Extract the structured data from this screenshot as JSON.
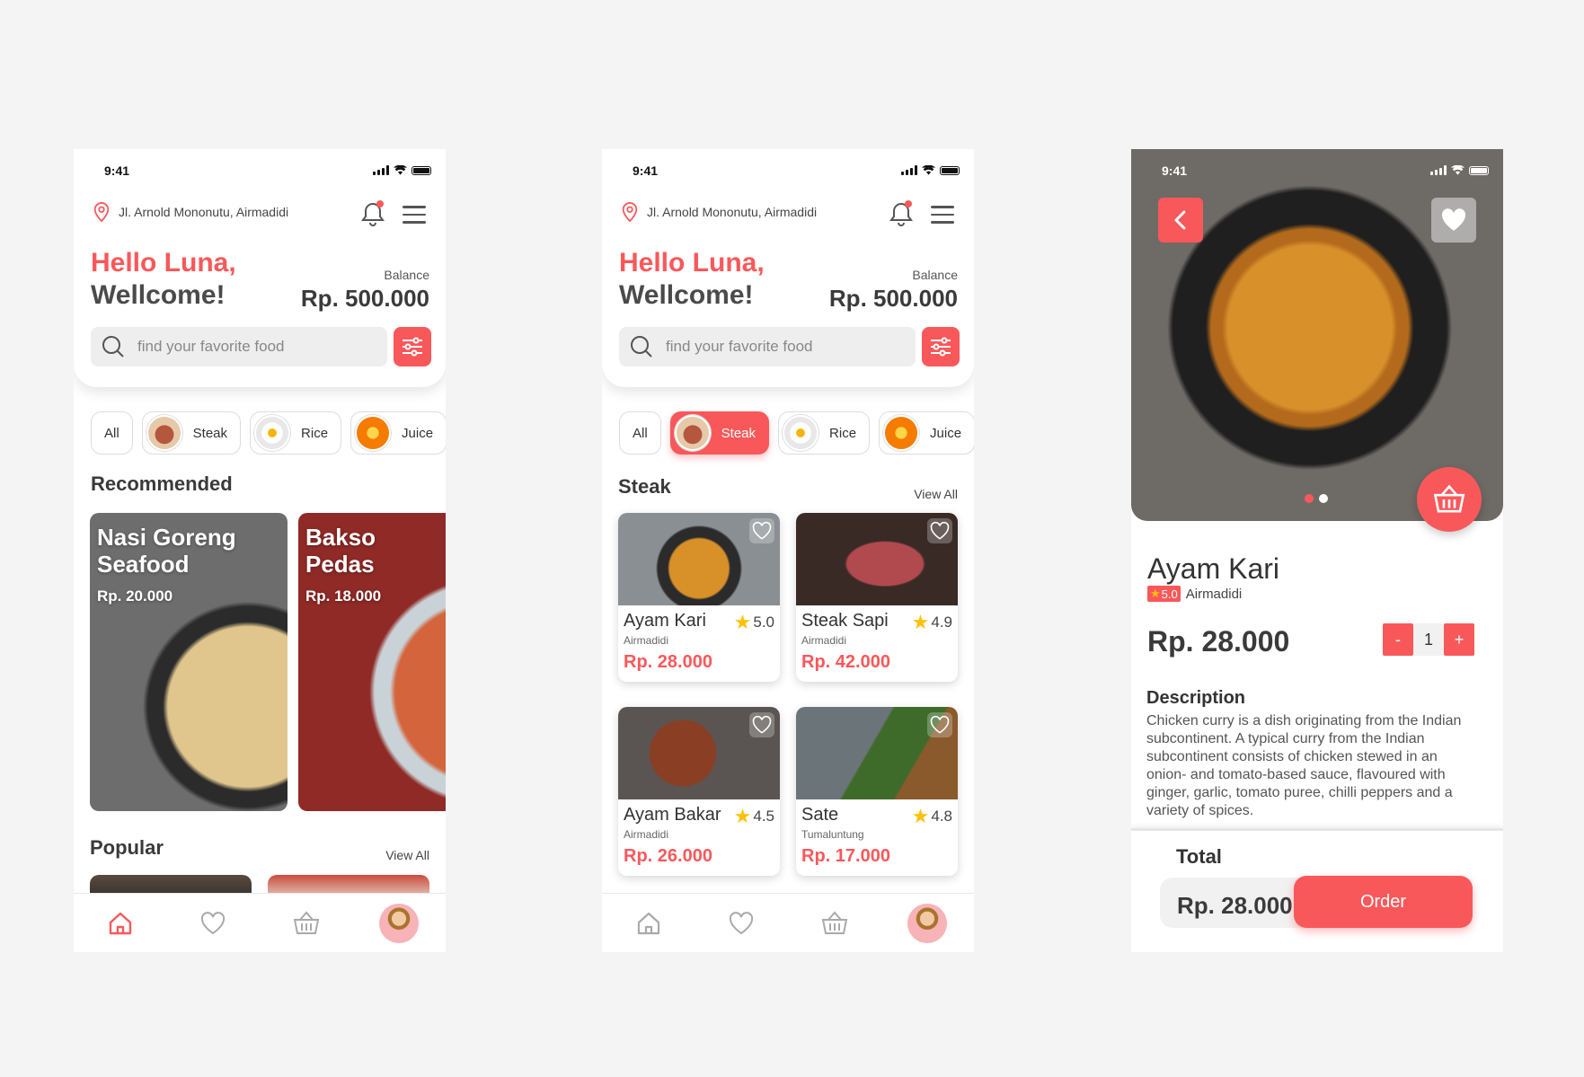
{
  "status": {
    "time": "9:41"
  },
  "home": {
    "location": "Jl. Arnold Mononutu, Airmadidi",
    "hello": "Hello Luna,",
    "welcome": "Wellcome!",
    "balance_label": "Balance",
    "balance_value": "Rp. 500.000",
    "search_placeholder": "find your favorite food",
    "categories": [
      {
        "label": "All"
      },
      {
        "label": "Steak"
      },
      {
        "label": "Rice"
      },
      {
        "label": "Juice"
      }
    ],
    "recommended_title": "Recommended",
    "recommended": [
      {
        "name": "Nasi Goreng Seafood",
        "price": "Rp. 20.000"
      },
      {
        "name": "Bakso Pedas",
        "price": "Rp. 18.000"
      }
    ],
    "popular_title": "Popular",
    "view_all": "View All"
  },
  "steak_page": {
    "title": "Steak",
    "view_all": "View All",
    "items": [
      {
        "name": "Ayam Kari",
        "rating": "5.0",
        "location": "Airmadidi",
        "price": "Rp. 28.000"
      },
      {
        "name": "Steak Sapi",
        "rating": "4.9",
        "location": "Airmadidi",
        "price": "Rp. 42.000"
      },
      {
        "name": "Ayam Bakar",
        "rating": "4.5",
        "location": "Airmadidi",
        "price": "Rp. 26.000"
      },
      {
        "name": "Sate",
        "rating": "4.8",
        "location": "Tumaluntung",
        "price": "Rp. 17.000"
      }
    ]
  },
  "detail": {
    "name": "Ayam Kari",
    "rating": "5.0",
    "location": "Airmadidi",
    "price": "Rp. 28.000",
    "qty_minus": "-",
    "qty_value": "1",
    "qty_plus": "+",
    "description_title": "Description",
    "description": "Chicken curry is a dish originating from the Indian subcontinent. A typical curry from the Indian subcontinent consists of chicken stewed in an onion- and tomato-based sauce, flavoured with ginger, garlic, tomato puree, chilli peppers and a variety of spices.",
    "total_label": "Total",
    "total_value": "Rp. 28.000",
    "order_label": "Order"
  },
  "colors": {
    "accent": "#f9585a",
    "text": "#3a3a3a",
    "background": "#f4f4f4"
  }
}
